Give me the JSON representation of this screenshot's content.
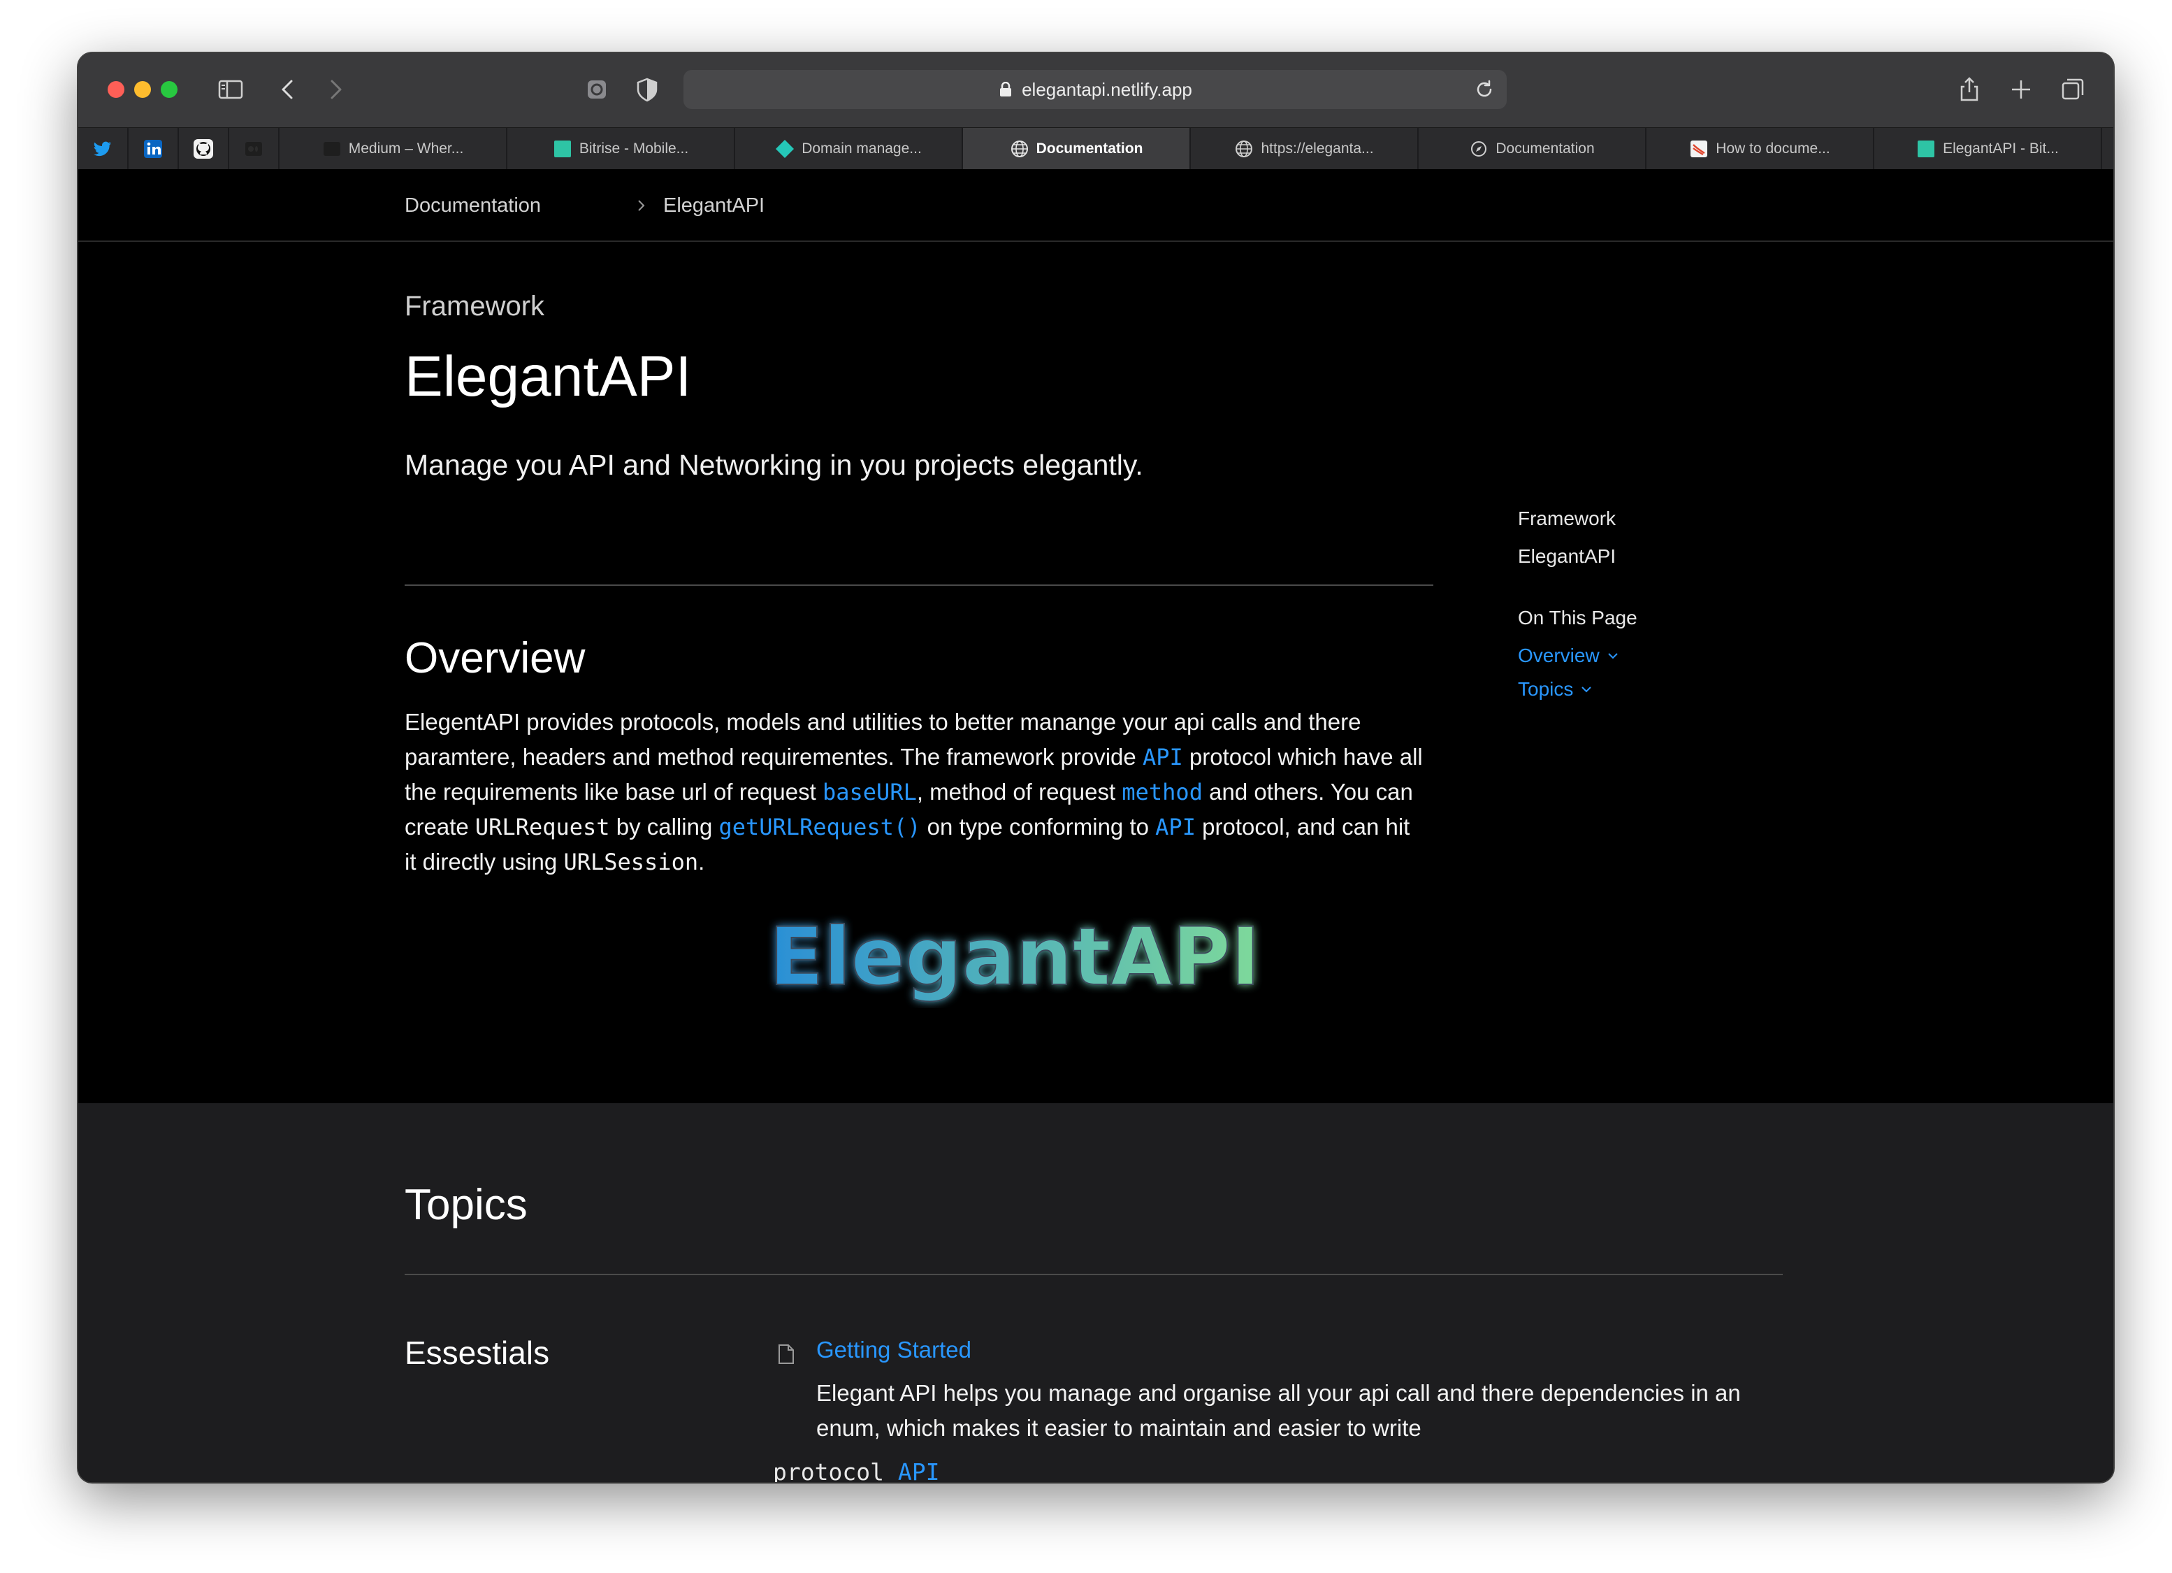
{
  "browser": {
    "url": "elegantapi.netlify.app",
    "pinned_tabs": [
      {
        "icon": "twitter-icon"
      },
      {
        "icon": "linkedin-icon"
      },
      {
        "icon": "github-icon"
      },
      {
        "icon": "medium-icon"
      }
    ],
    "tabs": [
      {
        "label": "Medium – Wher...",
        "icon": "medium-favicon",
        "active": false
      },
      {
        "label": "Bitrise - Mobile...",
        "icon": "bitrise-favicon",
        "active": false
      },
      {
        "label": "Domain manage...",
        "icon": "netlify-favicon",
        "active": false
      },
      {
        "label": "Documentation",
        "icon": "globe-favicon",
        "active": true
      },
      {
        "label": "https://eleganta...",
        "icon": "globe-favicon",
        "active": false
      },
      {
        "label": "Documentation",
        "icon": "compass-favicon",
        "active": false
      },
      {
        "label": "How to docume...",
        "icon": "swift-favicon",
        "active": false
      },
      {
        "label": "ElegantAPI - Bit...",
        "icon": "bitrise-favicon",
        "active": false
      }
    ]
  },
  "breadcrumb": {
    "items": [
      "Documentation",
      "ElegantAPI"
    ]
  },
  "hero": {
    "eyebrow": "Framework",
    "title": "ElegantAPI",
    "abstract": "Manage you API and Networking in you projects elegantly."
  },
  "overview": {
    "heading": "Overview",
    "p1": "ElegentAPI provides protocols, models and utilities to better manange your api calls and there",
    "p2a": "paramtere, headers and method requirementes. The framework provide ",
    "p2code": "API",
    "p2b": " protocol which have all",
    "p3a": "the requirements like base url of request ",
    "p3code1": "baseURL",
    "p3b": ", method of request ",
    "p3code2": "method",
    "p3c": " and others. You can",
    "p4a": "create ",
    "p4code1": "URLRequest",
    "p4b": " by calling ",
    "p4code2": "getURLRequest()",
    "p4c": " on type conforming to ",
    "p4code3": "API",
    "p4d": " protocol, and can hit",
    "p5a": "it directly using ",
    "p5code": "URLSession",
    "p5b": "."
  },
  "logo": {
    "text": "ElegantAPI",
    "colors": {
      "start": "#2a8fd6",
      "end": "#7ed99a"
    }
  },
  "sidebar": {
    "kind": "Framework",
    "name": "ElegantAPI",
    "on_this_page": "On This Page",
    "links": [
      "Overview",
      "Topics"
    ]
  },
  "topics": {
    "heading": "Topics",
    "group": "Essestials",
    "item_title": "Getting Started",
    "item_desc_1": "Elegant API helps you manage and organise all your api call and there dependencies in an",
    "item_desc_2": "enum, which makes it easier to maintain and easier to write",
    "protocol_keyword": "protocol",
    "protocol_name": "API"
  },
  "colors": {
    "link": "#2997ff",
    "page_bg": "#000000",
    "topics_bg": "#1d1d1f"
  }
}
